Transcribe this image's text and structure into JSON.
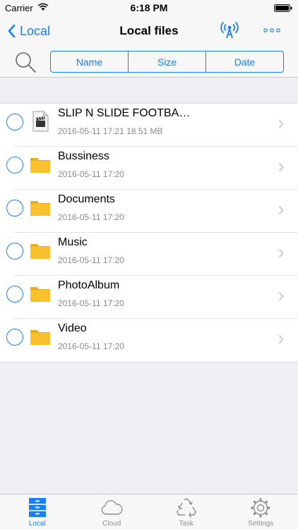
{
  "status_bar": {
    "carrier": "Carrier",
    "time": "6:18 PM"
  },
  "nav": {
    "back_label": "Local",
    "title": "Local files"
  },
  "sort": {
    "options": [
      "Name",
      "Size",
      "Date"
    ]
  },
  "files": [
    {
      "name": "SLIP N SLIDE FOOTBA…",
      "meta": "2016-05-11 17:21   18.51 MB",
      "icon": "video-file-icon"
    },
    {
      "name": "Bussiness",
      "meta": "2016-05-11 17:20",
      "icon": "folder-icon"
    },
    {
      "name": "Documents",
      "meta": "2016-05-11 17:20",
      "icon": "folder-icon"
    },
    {
      "name": "Music",
      "meta": "2016-05-11 17:20",
      "icon": "folder-icon"
    },
    {
      "name": "PhotoAlbum",
      "meta": "2016-05-11 17:20",
      "icon": "folder-icon"
    },
    {
      "name": "Video",
      "meta": "2016-05-11 17:20",
      "icon": "folder-icon"
    }
  ],
  "tabs": [
    {
      "label": "Local",
      "icon": "cabinet-icon",
      "active": true
    },
    {
      "label": "Cloud",
      "icon": "cloud-icon",
      "active": false
    },
    {
      "label": "Task",
      "icon": "recycle-icon",
      "active": false
    },
    {
      "label": "Settings",
      "icon": "gear-icon",
      "active": false
    }
  ],
  "colors": {
    "accent": "#1a7ff0",
    "folder": "#f9c12e",
    "background": "#efeff4"
  }
}
